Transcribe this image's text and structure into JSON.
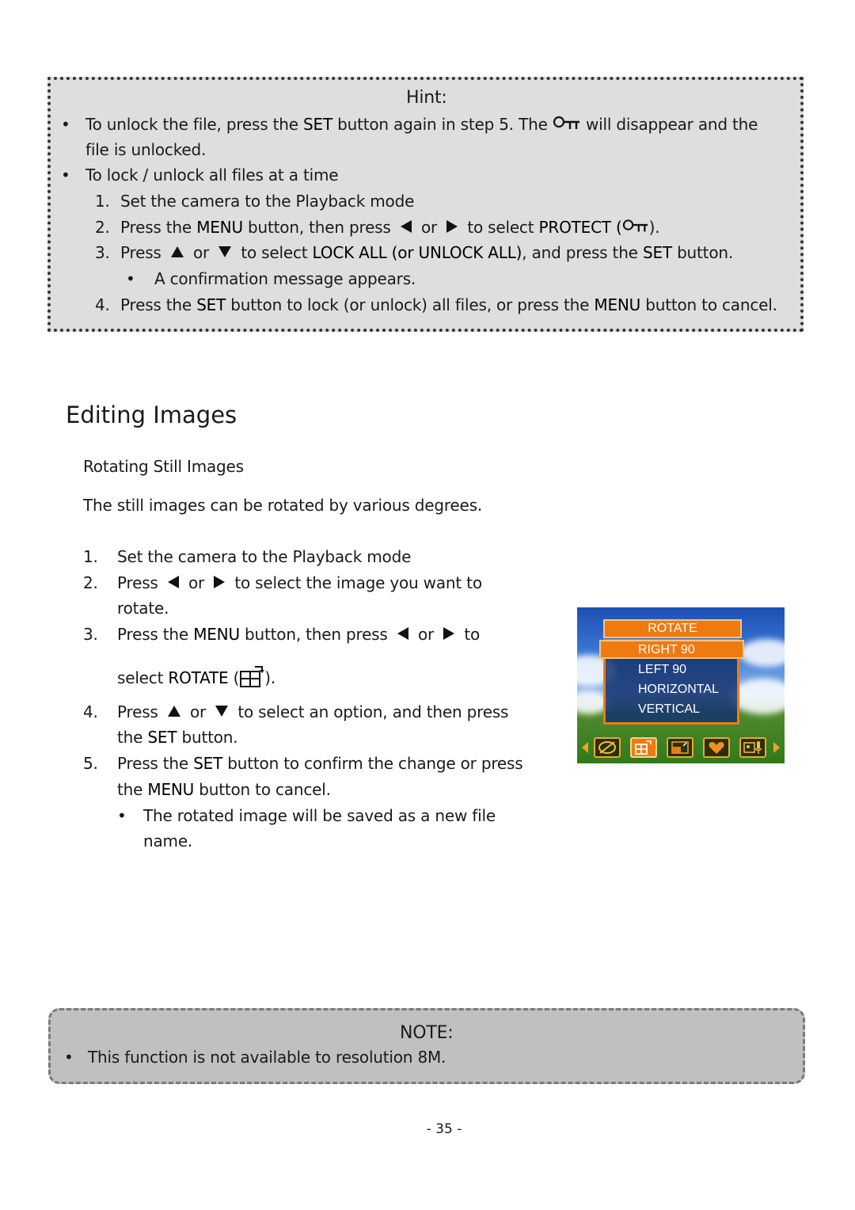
{
  "hint": {
    "title": "Hint:",
    "bullet1_a": "To unlock the file, press the ",
    "bullet1_set": "SET",
    "bullet1_b": " button again in step 5. The ",
    "bullet1_c": " will disappear and the",
    "bullet1_d": "file is unlocked.",
    "bullet2": "To lock / unlock all files at a time",
    "step1_num": "1.",
    "step1": "Set the camera to the Playback mode",
    "step2_num": "2.",
    "step2_a": "Press the ",
    "step2_menu": "MENU",
    "step2_b": " button, then press ",
    "step2_or": " or ",
    "step2_c": " to select ",
    "step2_protect": "PROTECT (",
    "step2_d": ").",
    "step3_num": "3.",
    "step3_a": "Press ",
    "step3_or": " or ",
    "step3_b": " to select ",
    "step3_lock": "LOCK ALL (or UNLOCK ALL)",
    "step3_c": ", and press the ",
    "step3_set": "SET",
    "step3_d": " button.",
    "step3_sub": "A confirmation message appears.",
    "step4_num": "4.",
    "step4_a": "Press the ",
    "step4_set": "SET",
    "step4_b": " button to lock (or unlock) all files, or press the ",
    "step4_menu": "MENU",
    "step4_c": " button to cancel.",
    "bullet_glyph": "•"
  },
  "section": {
    "title": "Editing Images",
    "subtitle": "Rotating Still Images",
    "intro": "The still images can be rotated by various degrees."
  },
  "steps": {
    "s1_num": "1.",
    "s1": "Set the camera to the Playback mode",
    "s2_num": "2.",
    "s2_a": "Press ",
    "s2_or": " or ",
    "s2_b": " to select the image you want to",
    "s2_c": "rotate.",
    "s3_num": "3.",
    "s3_a": "Press the ",
    "s3_menu": "MENU",
    "s3_b": " button, then press ",
    "s3_or": " or ",
    "s3_c": " to",
    "s3_d": "select ",
    "s3_rotate": "ROTATE",
    "s3_e": " (",
    "s3_f": ").",
    "s4_num": "4.",
    "s4_a": "Press ",
    "s4_or": " or ",
    "s4_b": " to select an option, and then press",
    "s4_c": "the ",
    "s4_set": "SET",
    "s4_d": " button.",
    "s5_num": "5.",
    "s5_a": "Press the ",
    "s5_set": "SET",
    "s5_b": " button to confirm the change or press",
    "s5_c": "the ",
    "s5_menu": "MENU",
    "s5_d": " button to cancel.",
    "s5_sub_a": "The rotated image will be saved as a new file",
    "s5_sub_b": "name.",
    "bullet_glyph": "•"
  },
  "camera_screen": {
    "menu_title": "ROTATE",
    "options": [
      "RIGHT 90",
      "LEFT 90",
      "HORIZONTAL",
      "VERTICAL"
    ],
    "selected_option": "RIGHT 90",
    "toolbar_icons": [
      "effect-palette-icon",
      "rotate-icon",
      "resize-icon",
      "favorite-heart-icon",
      "voice-memo-icon"
    ],
    "active_toolbar_icon": "rotate-icon",
    "accent_color": "#f07a12"
  },
  "note": {
    "title": "NOTE:",
    "bullet": "This function is not available to resolution 8M.",
    "bullet_glyph": "•"
  },
  "footer": {
    "page_number": "- 35 -"
  }
}
